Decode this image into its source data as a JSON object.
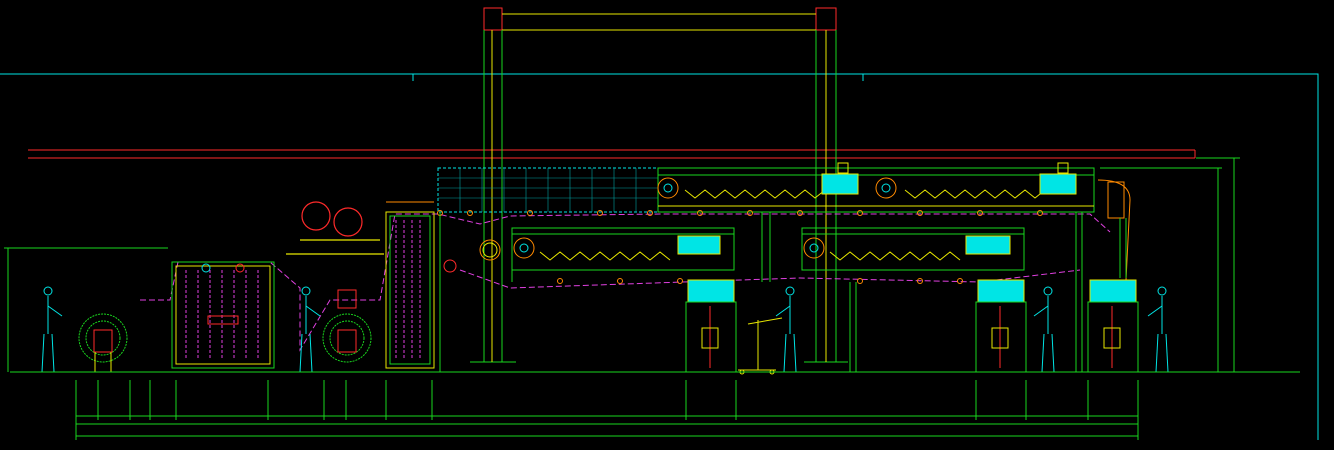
{
  "drawing": {
    "background": "#000000",
    "colors": {
      "yellow": "#e8e800",
      "green": "#19d61e",
      "cyan": "#00e5e5",
      "red": "#ff2a2a",
      "magenta": "#e040e0",
      "white": "#d8d8d8",
      "orange": "#ff8a00"
    },
    "layer_labels": [
      "frame",
      "dimension-lines",
      "operators",
      "rollers",
      "dryer-hoods",
      "coating-heads"
    ]
  }
}
